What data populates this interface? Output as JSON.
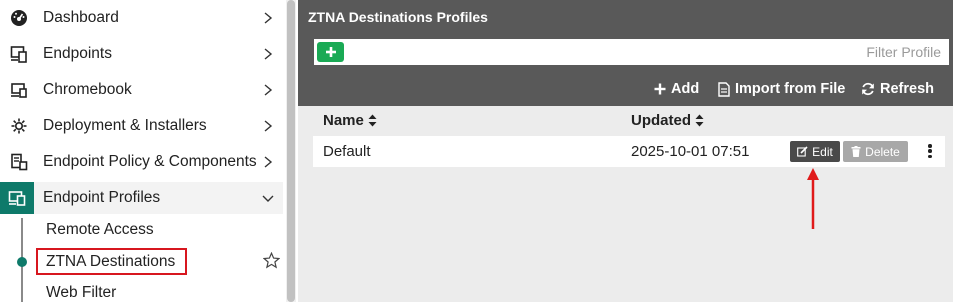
{
  "sidebar": {
    "items": [
      {
        "label": "Dashboard",
        "icon": "dashboard-gauge-icon"
      },
      {
        "label": "Endpoints",
        "icon": "devices-icon"
      },
      {
        "label": "Chromebook",
        "icon": "laptop-icon"
      },
      {
        "label": "Deployment & Installers",
        "icon": "gear-installer-icon"
      },
      {
        "label": "Endpoint Policy & Components",
        "icon": "policy-document-icon"
      },
      {
        "label": "Endpoint Profiles",
        "icon": "profile-devices-icon"
      }
    ],
    "subitems": [
      {
        "label": "Remote Access"
      },
      {
        "label": "ZTNA Destinations"
      },
      {
        "label": "Web Filter"
      }
    ]
  },
  "main": {
    "title": "ZTNA Destinations Profiles",
    "filter_placeholder": "Filter Profile",
    "toolbar": {
      "add_label": "Add",
      "import_label": "Import from File",
      "refresh_label": "Refresh"
    },
    "table": {
      "columns": [
        "Name",
        "Updated"
      ],
      "rows": [
        {
          "name": "Default",
          "updated": "2025-10-01 07:51"
        }
      ],
      "edit_label": "Edit",
      "delete_label": "Delete"
    }
  },
  "colors": {
    "accent": "#0e7a6a",
    "header_bg": "#595959",
    "add_button": "#1aaa55",
    "highlight": "#d7161f"
  }
}
